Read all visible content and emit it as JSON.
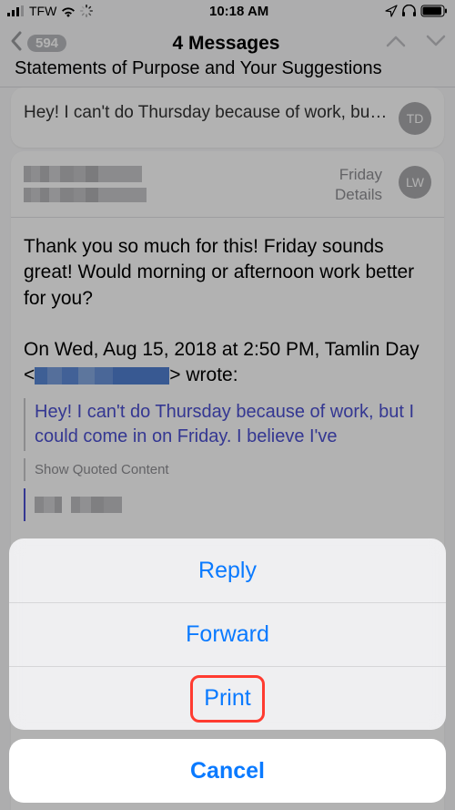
{
  "status": {
    "carrier": "TFW",
    "time": "10:18 AM"
  },
  "nav": {
    "count": "594",
    "title": "4 Messages",
    "subject": "Statements of Purpose and Your Suggestions"
  },
  "msg1": {
    "avatar_initials": "TD",
    "preview": "Hey! I can't do Thursday because of work, but I co..."
  },
  "msg2": {
    "avatar_initials": "LW",
    "date_label": "Friday",
    "details_label": "Details",
    "body_p1": "Thank you so much for this! Friday sounds great! Would morning or afternoon work better for you?",
    "reply_prefix": "On Wed, Aug 15, 2018 at 2:50 PM, Tamlin Day <",
    "reply_suffix": "> wrote:",
    "quoted_text": "Hey! I can't do Thursday because of work, but I could come in on Friday. I believe I've",
    "show_quoted": "Show Quoted Content"
  },
  "sheet": {
    "reply": "Reply",
    "forward": "Forward",
    "print": "Print",
    "cancel": "Cancel"
  }
}
